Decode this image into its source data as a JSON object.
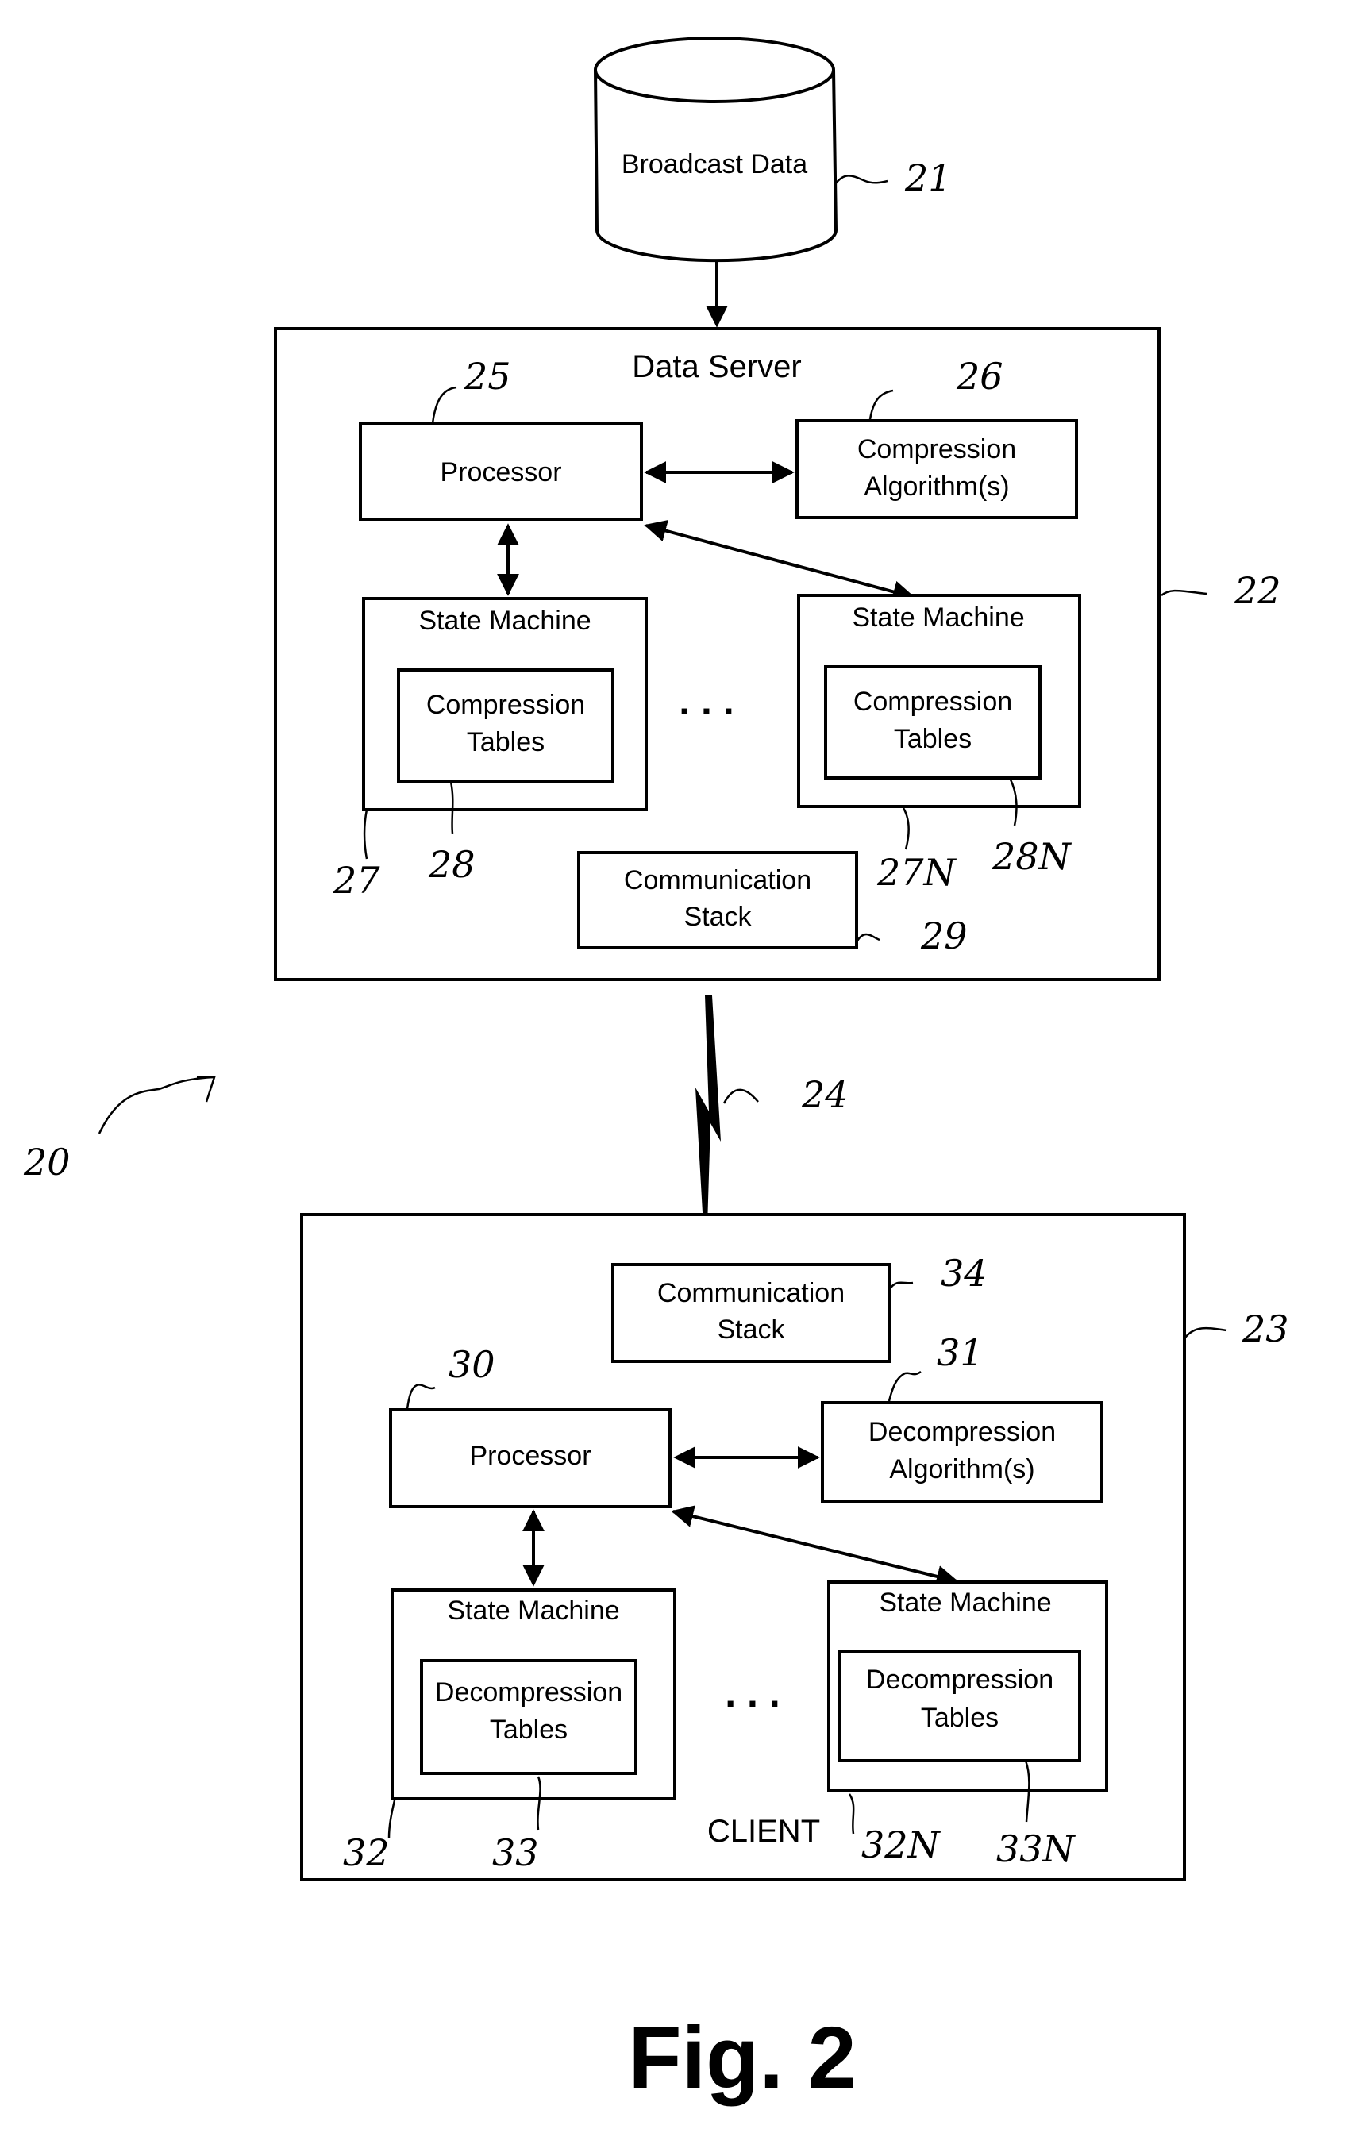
{
  "figure": {
    "caption": "Fig. 2",
    "system_ref": "20",
    "link_ref": "24"
  },
  "broadcast_data": {
    "label": "Broadcast Data",
    "ref": "21"
  },
  "data_server": {
    "title": "Data Server",
    "ref": "22",
    "processor": {
      "label": "Processor",
      "ref": "25"
    },
    "algorithm": {
      "line1": "Compression",
      "line2": "Algorithm(s)",
      "ref": "26"
    },
    "state_machines": [
      {
        "title": "State Machine",
        "table_line1": "Compression",
        "table_line2": "Tables",
        "ref": "27",
        "table_ref": "28"
      },
      {
        "title": "State Machine",
        "table_line1": "Compression",
        "table_line2": "Tables",
        "ref": "27N",
        "table_ref": "28N"
      }
    ],
    "ellipsis": ". . .",
    "comm_stack": {
      "line1": "Communication",
      "line2": "Stack",
      "ref": "29"
    }
  },
  "client": {
    "title": "CLIENT",
    "ref": "23",
    "comm_stack": {
      "line1": "Communication",
      "line2": "Stack",
      "ref": "34"
    },
    "processor": {
      "label": "Processor",
      "ref": "30"
    },
    "algorithm": {
      "line1": "Decompression",
      "line2": "Algorithm(s)",
      "ref": "31"
    },
    "state_machines": [
      {
        "title": "State Machine",
        "table_line1": "Decompression",
        "table_line2": "Tables",
        "ref": "32",
        "table_ref": "33"
      },
      {
        "title": "State Machine",
        "table_line1": "Decompression",
        "table_line2": "Tables",
        "ref": "32N",
        "table_ref": "33N"
      }
    ],
    "ellipsis": ". . ."
  }
}
